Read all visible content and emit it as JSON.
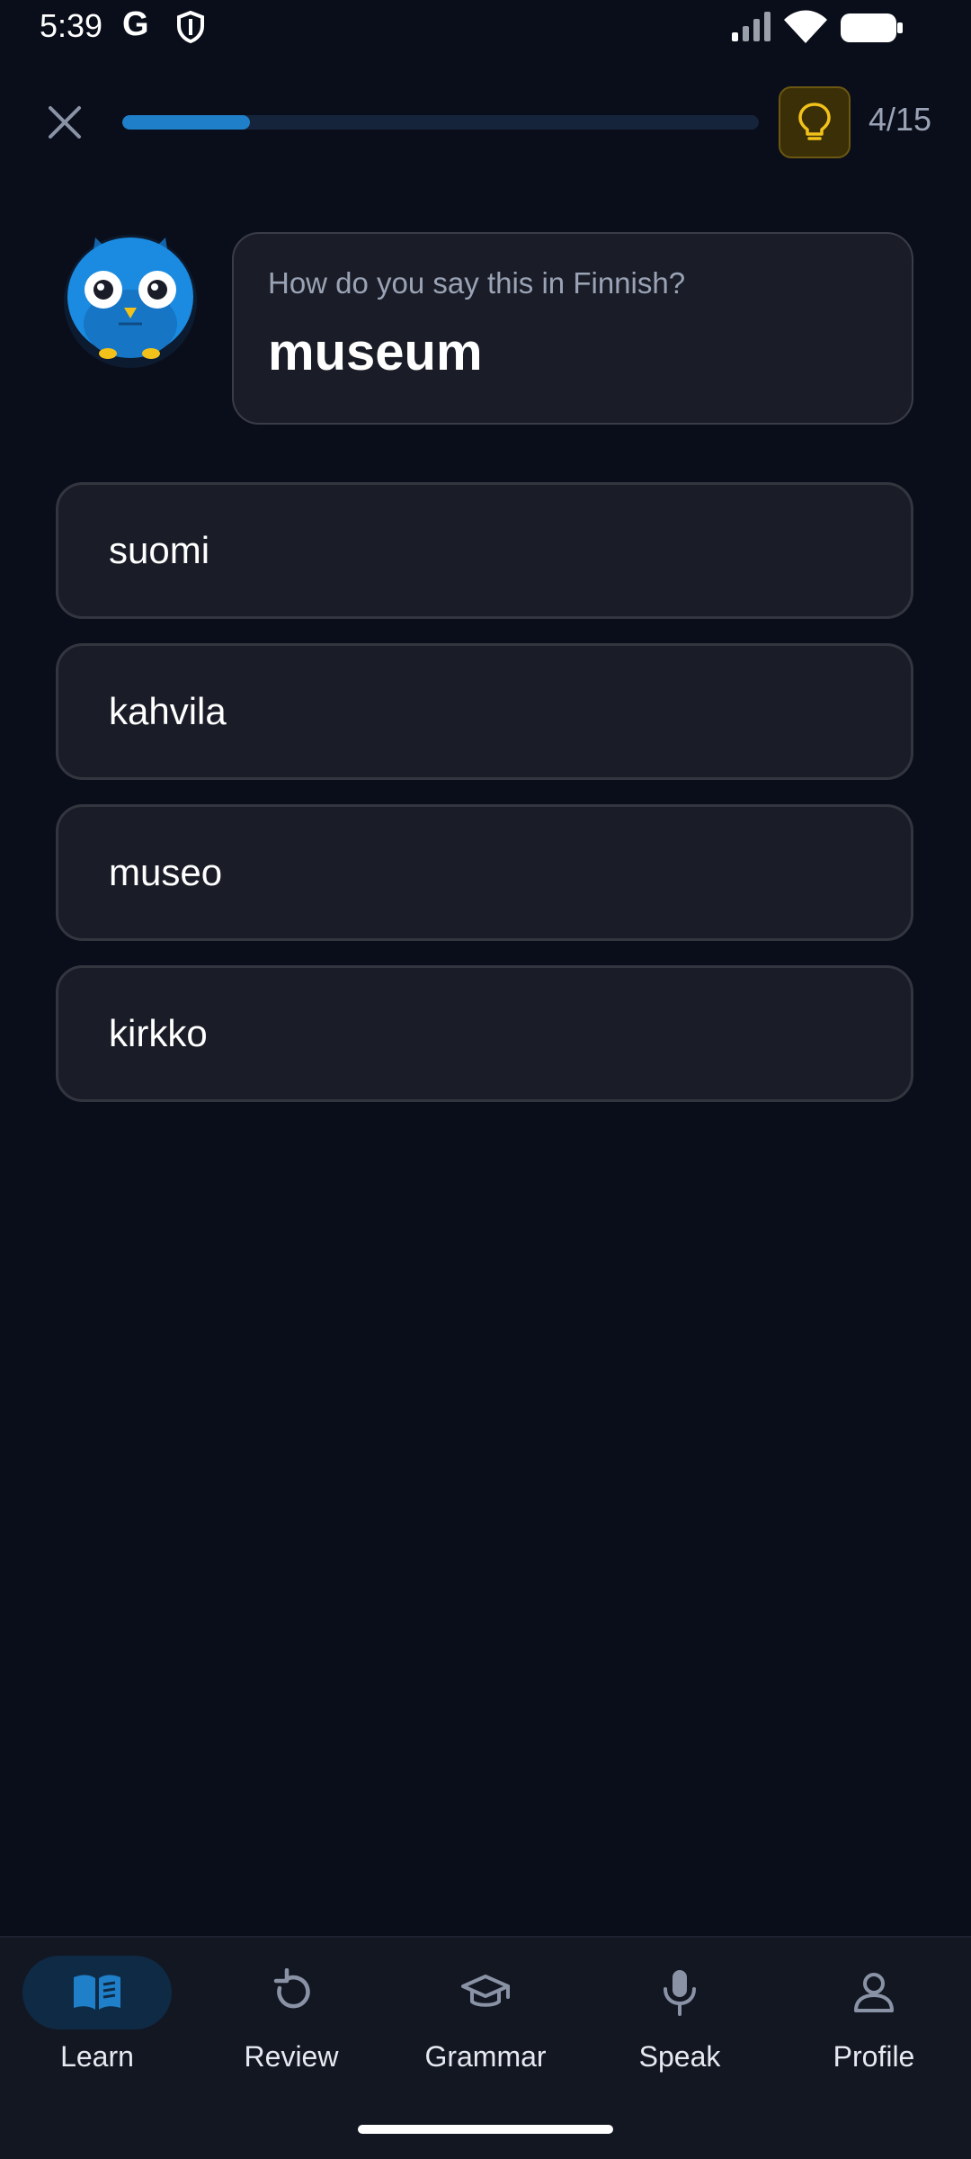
{
  "status_bar": {
    "time": "5:39",
    "g_letter": "G"
  },
  "top_bar": {
    "progress": 0.2,
    "counter": "4/15"
  },
  "prompt": {
    "question": "How do you say this in Finnish?",
    "word": "museum"
  },
  "options": [
    {
      "label": "suomi"
    },
    {
      "label": "kahvila"
    },
    {
      "label": "museo"
    },
    {
      "label": "kirkko"
    }
  ],
  "nav": {
    "items": [
      {
        "label": "Learn",
        "icon": "book-icon",
        "active": true
      },
      {
        "label": "Review",
        "icon": "refresh-icon",
        "active": false
      },
      {
        "label": "Grammar",
        "icon": "graduation-cap-icon",
        "active": false
      },
      {
        "label": "Speak",
        "icon": "microphone-icon",
        "active": false
      },
      {
        "label": "Profile",
        "icon": "person-icon",
        "active": false
      }
    ]
  },
  "colors": {
    "background": "#0a0e1a",
    "accent": "#1f7fc8",
    "hint": "#f2c21b"
  }
}
